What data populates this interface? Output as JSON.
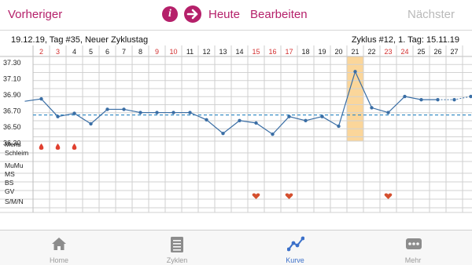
{
  "nav": {
    "prev_label": "Vorheriger",
    "info_icon_text": "i",
    "today_label": "Heute",
    "edit_label": "Bearbeiten",
    "next_label": "Nächster"
  },
  "header": {
    "left": "19.12.19, Tag #35, Neuer Zyklustag",
    "right": "Zyklus #12, 1. Tag: 15.11.19"
  },
  "colors": {
    "accent": "#b5206a",
    "red_day": "#d23131",
    "line": "#3a6ea5",
    "coverline": "#3a8fc7",
    "highlight": "#fbd69a",
    "tab_active": "#3b70c9",
    "tab_inactive": "#9a9a9a"
  },
  "chart_data": {
    "type": "line",
    "days": [
      "2",
      "3",
      "4",
      "5",
      "6",
      "7",
      "8",
      "9",
      "10",
      "11",
      "12",
      "13",
      "14",
      "15",
      "16",
      "17",
      "18",
      "19",
      "20",
      "21",
      "22",
      "23",
      "24",
      "25",
      "26",
      "27"
    ],
    "red_days": [
      "2",
      "3",
      "9",
      "10",
      "15",
      "16",
      "17",
      "23",
      "24"
    ],
    "highlight_day": "21",
    "y_ticks": [
      "37.30",
      "37.10",
      "36.90",
      "36.70",
      "36.50",
      "36.30"
    ],
    "ylim": [
      36.2,
      37.4
    ],
    "coverline": 36.65,
    "series": [
      {
        "values": [
          36.82,
          36.85,
          36.63,
          36.67,
          36.54,
          36.72,
          36.72,
          36.68,
          36.68,
          36.68,
          36.68,
          36.59,
          36.42,
          36.58,
          36.55,
          36.41,
          36.63,
          36.58,
          36.63,
          36.51,
          37.19,
          36.74,
          36.68,
          36.88,
          36.84,
          36.84,
          36.84,
          36.88
        ]
      }
    ],
    "row_labels": [
      "Mens",
      "Schleim",
      "MuMu",
      "MS",
      "BS",
      "GV",
      "S/M/N"
    ],
    "mens_days": [
      "2",
      "3",
      "4"
    ],
    "gv_days": [
      "15",
      "17",
      "23"
    ]
  },
  "tabs": [
    {
      "label": "Home",
      "icon": "home-icon"
    },
    {
      "label": "Zyklen",
      "icon": "list-icon"
    },
    {
      "label": "Kurve",
      "icon": "chart-icon",
      "active": true
    },
    {
      "label": "Mehr",
      "icon": "more-icon"
    }
  ]
}
